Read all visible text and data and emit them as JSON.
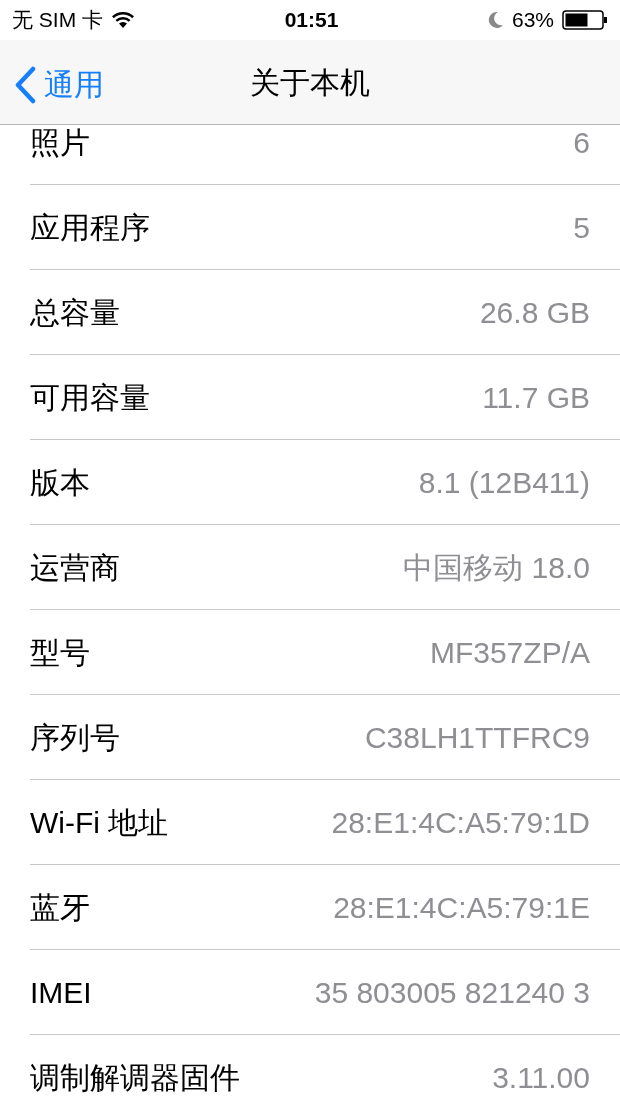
{
  "status_bar": {
    "carrier": "无 SIM 卡",
    "time": "01:51",
    "battery": "63%"
  },
  "nav": {
    "back": "通用",
    "title": "关于本机"
  },
  "rows": [
    {
      "label": "照片",
      "value": "6"
    },
    {
      "label": "应用程序",
      "value": "5"
    },
    {
      "label": "总容量",
      "value": "26.8 GB"
    },
    {
      "label": "可用容量",
      "value": "11.7 GB"
    },
    {
      "label": "版本",
      "value": "8.1 (12B411)"
    },
    {
      "label": "运营商",
      "value": "中国移动 18.0"
    },
    {
      "label": "型号",
      "value": "MF357ZP/A"
    },
    {
      "label": "序列号",
      "value": "C38LH1TTFRC9"
    },
    {
      "label": "Wi-Fi 地址",
      "value": "28:E1:4C:A5:79:1D"
    },
    {
      "label": "蓝牙",
      "value": "28:E1:4C:A5:79:1E"
    },
    {
      "label": "IMEI",
      "value": "35 803005 821240 3"
    },
    {
      "label": "调制解调器固件",
      "value": "3.11.00"
    }
  ]
}
